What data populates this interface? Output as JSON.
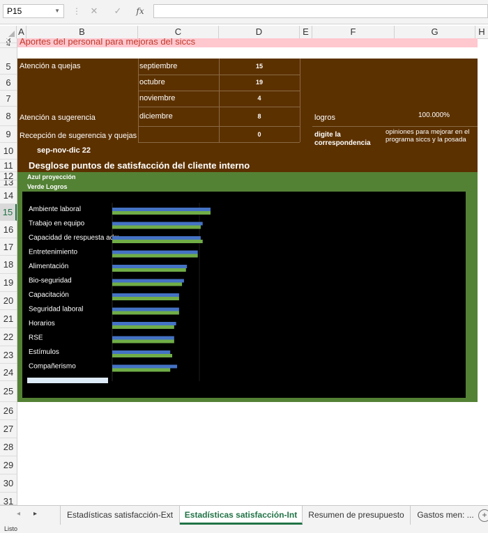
{
  "name_box": "P15",
  "formula_bar": {
    "cancel_icon": "✕",
    "enter_icon": "✓",
    "fx_label": "fx",
    "content": ""
  },
  "columns": [
    "A",
    "B",
    "C",
    "D",
    "E",
    "F",
    "G",
    "H"
  ],
  "rows": [
    "3",
    "4",
    "5",
    "6",
    "7",
    "8",
    "9",
    "10",
    "11",
    "12",
    "13",
    "14",
    "15",
    "16",
    "17",
    "18",
    "19",
    "20",
    "21",
    "22",
    "23",
    "24",
    "25",
    "26",
    "27",
    "28",
    "29",
    "30",
    "31"
  ],
  "selected_row": "15",
  "sheet": {
    "title": "Aportes del personal para mejoras del siccs",
    "queries_label": "Atención a quejas",
    "suggestion_label": "Atención a sugerencia",
    "reception_label": "Recepción de sugerencia y quejas",
    "period": "sep-nov-dic 22",
    "months": [
      {
        "month": "septiembre",
        "value": "15"
      },
      {
        "month": "octubre",
        "value": "19"
      },
      {
        "month": "noviembre",
        "value": "4"
      },
      {
        "month": "diciembre",
        "value": "8"
      },
      {
        "month": "",
        "value": "0"
      }
    ],
    "logros_label": "logros",
    "logros_value": "100.000%",
    "digite_label": "digite la correspondencia",
    "opinion_text": "opiniones para mejorar en el programa siccs y la posada",
    "breakdown_title": "Desglose puntos de satisfacción del cliente interno",
    "legend_blue": "Azul proyección",
    "legend_green": "Verde Logros"
  },
  "chart_data": {
    "type": "bar",
    "orientation": "horizontal",
    "categories": [
      "Ambiente laboral",
      "Trabajo en equipo",
      "Capacidad de respuesta adm",
      "Entretenimiento",
      "Alimentación",
      "Bio-seguridad",
      "Capacitación",
      "Seguridad laboral",
      "Horarios",
      "RSE",
      "Estímulos",
      "Compañerismo",
      ""
    ],
    "series": [
      {
        "name": "Azul proyección",
        "color": "#4472c4",
        "values": [
          100,
          92,
          90,
          87,
          76,
          73,
          68,
          68,
          65,
          63,
          59,
          66
        ]
      },
      {
        "name": "Verde Logros",
        "color": "#70ad47",
        "values": [
          100,
          90,
          92,
          87,
          75,
          71,
          68,
          68,
          63,
          63,
          61,
          59
        ]
      }
    ],
    "xlim": [
      0,
      100
    ],
    "grid": false
  },
  "tabs": {
    "items": [
      "Estadísticas satisfacción-Ext",
      "Estadísticas satisfacción-Int",
      "Resumen de presupuesto",
      "Gastos men: ..."
    ],
    "active_index": 1,
    "add_label": "+"
  },
  "status_text": "Listo"
}
